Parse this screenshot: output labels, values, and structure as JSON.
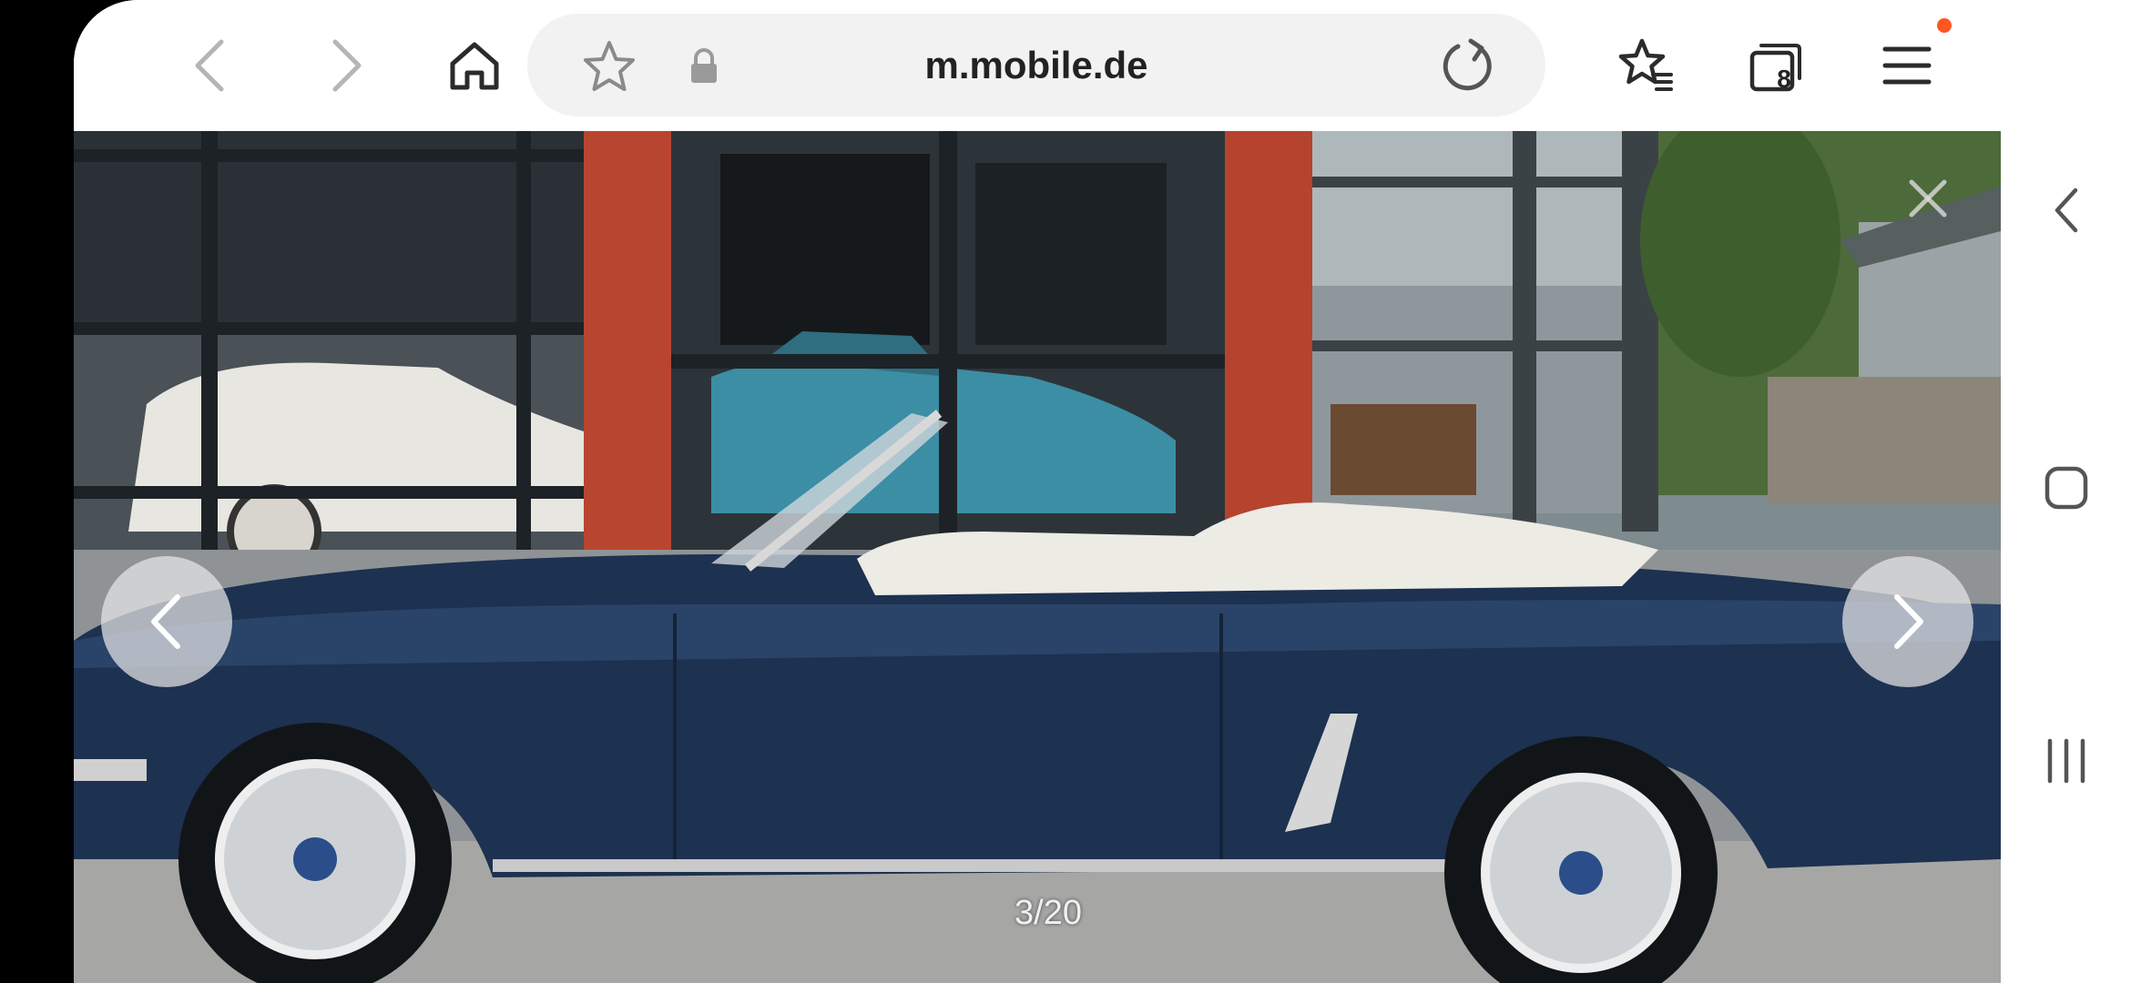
{
  "browser": {
    "url": "m.mobile.de",
    "tab_count": "8",
    "accent_color": "#ff5722"
  },
  "toolbar": {
    "icons": [
      "chevron-left-icon",
      "chevron-right-icon",
      "home-icon",
      "bookmark-star-icon",
      "lock-icon",
      "reload-icon",
      "bookmarks-list-icon",
      "tabs-icon",
      "menu-icon"
    ]
  },
  "gallery": {
    "counter": "3/20",
    "current": 3,
    "total": 20,
    "icons": [
      "gallery-prev-icon",
      "gallery-next-icon",
      "close-icon"
    ]
  },
  "system_nav": {
    "icons": [
      "back-icon",
      "home-square-icon",
      "recents-icon"
    ]
  }
}
